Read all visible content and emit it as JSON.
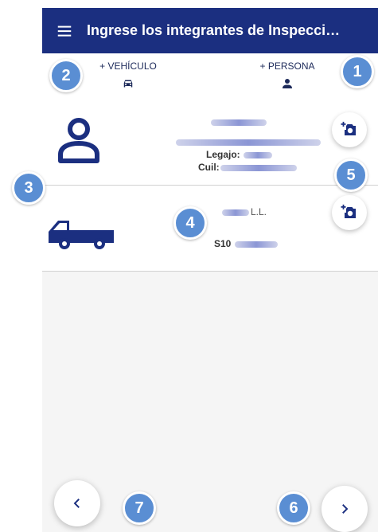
{
  "header": {
    "title": "Ingrese los integrantes de Inspecci…",
    "menu_icon": "hamburger-menu-icon"
  },
  "tabs": {
    "vehicle_label": "+ VEHÍCULO",
    "vehicle_icon": "car-icon",
    "person_label": "+ PERSONA",
    "person_icon": "person-icon"
  },
  "list": {
    "person_card": {
      "legajo_label": "Legajo:",
      "cuil_label": "Cuil:",
      "icon": "person-outline-icon",
      "camera_icon": "add-photo-icon"
    },
    "vehicle_card": {
      "company_suffix": "L.L.",
      "plate_prefix": "S10",
      "icon": "pickup-truck-icon",
      "camera_icon": "add-photo-icon"
    }
  },
  "footer": {
    "prev_icon": "chevron-left-icon",
    "next_icon": "chevron-right-icon"
  },
  "annotations": [
    "1",
    "2",
    "3",
    "4",
    "5",
    "6",
    "7"
  ],
  "colors": {
    "primary": "#1b2f80",
    "badge": "#5a8ed3",
    "background": "#f5f5f5"
  }
}
